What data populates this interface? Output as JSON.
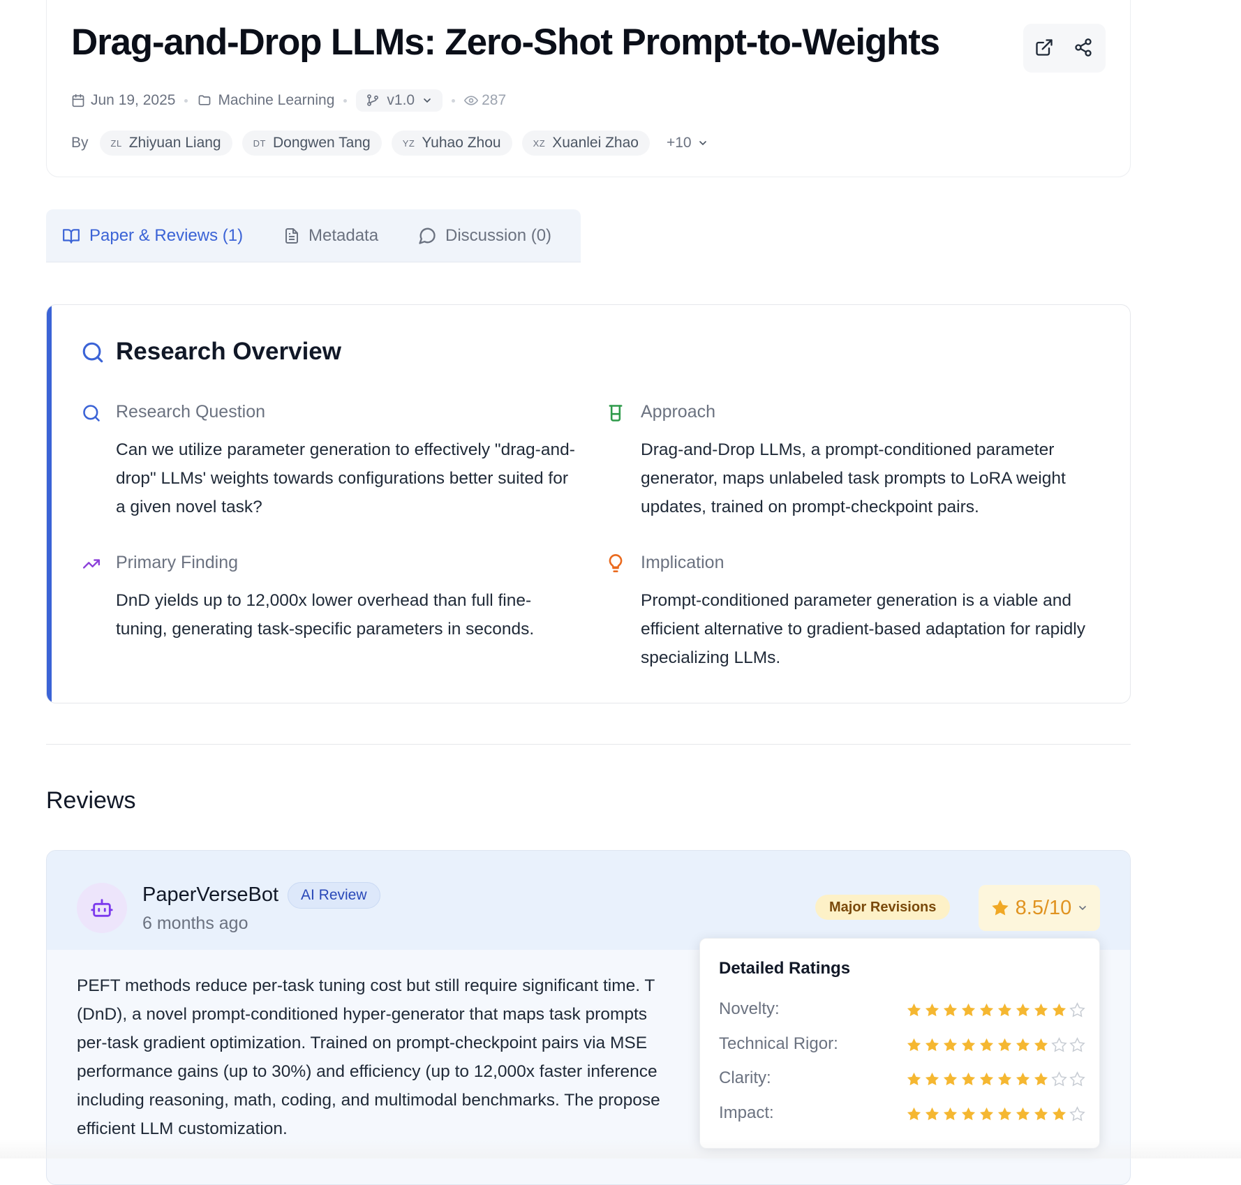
{
  "paper": {
    "title": "Drag-and-Drop LLMs: Zero-Shot Prompt-to-Weights",
    "date": "Jun 19, 2025",
    "category": "Machine Learning",
    "version": "v1.0",
    "views": "287",
    "by_label": "By",
    "authors": [
      {
        "initials": "ZL",
        "name": "Zhiyuan Liang"
      },
      {
        "initials": "DT",
        "name": "Dongwen Tang"
      },
      {
        "initials": "YZ",
        "name": "Yuhao Zhou"
      },
      {
        "initials": "XZ",
        "name": "Xuanlei Zhao"
      }
    ],
    "more_authors": "+10"
  },
  "tabs": [
    {
      "label": "Paper & Reviews (1)",
      "active": true
    },
    {
      "label": "Metadata",
      "active": false
    },
    {
      "label": "Discussion (0)",
      "active": false
    }
  ],
  "overview": {
    "title": "Research Overview",
    "question_label": "Research Question",
    "question_text": "Can we utilize parameter generation to effectively \"drag-and-drop\" LLMs' weights towards configurations better suited for a given novel task?",
    "approach_label": "Approach",
    "approach_text": "Drag-and-Drop LLMs, a prompt-conditioned parameter generator, maps unlabeled task prompts to LoRA weight updates, trained on prompt-checkpoint pairs.",
    "finding_label": "Primary Finding",
    "finding_text": "DnD yields up to 12,000x lower overhead than full fine-tuning, generating task-specific parameters in seconds.",
    "implication_label": "Implication",
    "implication_text": "Prompt-conditioned parameter generation is a viable and efficient alternative to gradient-based adaptation for rapidly specializing LLMs."
  },
  "reviews": {
    "heading": "Reviews",
    "items": [
      {
        "reviewer": "PaperVerseBot",
        "badge": "AI Review",
        "time": "6 months ago",
        "decision": "Major Revisions",
        "score": "8.5/10",
        "summary_lines": [
          "PEFT methods reduce per-task tuning cost but still require significant time. T",
          "(DnD), a novel prompt-conditioned hyper-generator that maps task prompts",
          "per-task gradient optimization. Trained on prompt-checkpoint pairs via MSE",
          "performance gains (up to 30%) and efficiency (up to 12,000x faster inference",
          "including reasoning, math, coding, and multimodal benchmarks. The propose",
          "efficient LLM customization."
        ],
        "ratings_title": "Detailed Ratings",
        "ratings": [
          {
            "label": "Novelty:",
            "value": 9,
            "max": 10
          },
          {
            "label": "Technical Rigor:",
            "value": 8,
            "max": 10
          },
          {
            "label": "Clarity:",
            "value": 8,
            "max": 10
          },
          {
            "label": "Impact:",
            "value": 9,
            "max": 10
          }
        ]
      }
    ]
  },
  "icons": {
    "calendar": "calendar-icon",
    "folder": "folder-icon",
    "branch": "git-branch-icon",
    "eye": "eye-icon",
    "external": "external-link-icon",
    "share": "share-icon",
    "book": "book-open-icon",
    "file": "file-text-icon",
    "chat": "message-circle-icon",
    "search": "search-icon",
    "flask": "beaker-icon",
    "trend": "trending-up-icon",
    "bulb": "lightbulb-icon",
    "bot": "bot-icon",
    "star": "star-icon"
  },
  "colors": {
    "accent": "#3b63d6",
    "star": "#f5b731",
    "approach_icon": "#2e9a4a",
    "finding_icon": "#8b3fd9",
    "implication_icon": "#ea6a1e",
    "decision_bg": "#fdf1c7"
  }
}
